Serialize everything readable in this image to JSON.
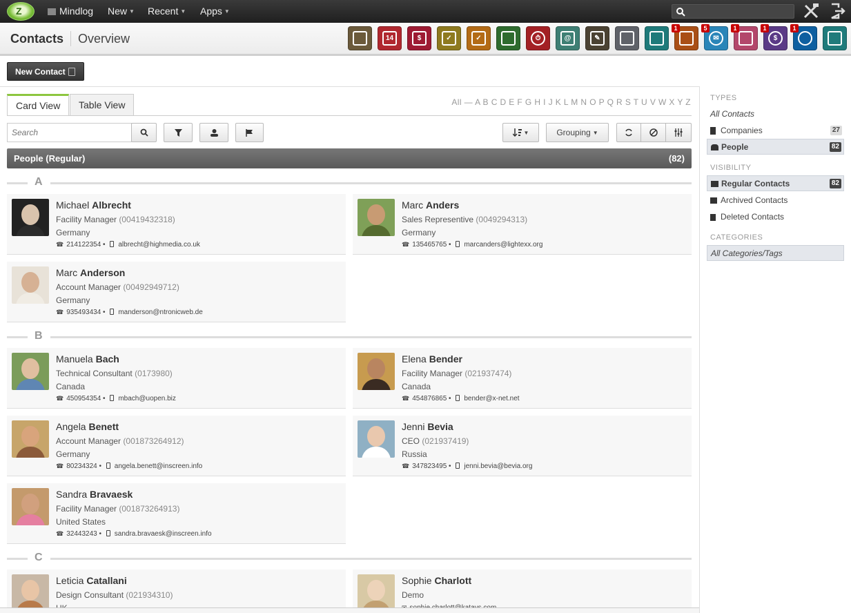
{
  "topbar": {
    "logo_text": "Z",
    "brand": "Mindlog",
    "nav": [
      {
        "label": "New"
      },
      {
        "label": "Recent"
      },
      {
        "label": "Apps"
      }
    ]
  },
  "header": {
    "title": "Contacts",
    "subtitle": "Overview"
  },
  "app_tiles": [
    {
      "name": "contacts-app-icon",
      "color": "#6b5a3b",
      "badge": "",
      "glyph": ""
    },
    {
      "name": "calendar-app-icon",
      "color": "#b0282f",
      "badge": "",
      "glyph": "14"
    },
    {
      "name": "sales-app-icon",
      "color": "#9e1b33",
      "badge": "",
      "glyph": "$"
    },
    {
      "name": "tasks-app-icon",
      "color": "#8e7a1f",
      "badge": "",
      "glyph": "✓"
    },
    {
      "name": "documents-app-icon",
      "color": "#b36b16",
      "badge": "",
      "glyph": "✓"
    },
    {
      "name": "bookmarks-app-icon",
      "color": "#2e6b2e",
      "badge": "",
      "glyph": ""
    },
    {
      "name": "timetracking-app-icon",
      "color": "#a32024",
      "badge": "",
      "glyph": "⏱"
    },
    {
      "name": "addressbook-app-icon",
      "color": "#3e7f74",
      "badge": "",
      "glyph": "@"
    },
    {
      "name": "notes-app-icon",
      "color": "#4b4233",
      "badge": "",
      "glyph": "✎"
    },
    {
      "name": "logistics-app-icon",
      "color": "#5f6269",
      "badge": "",
      "glyph": ""
    },
    {
      "name": "delivery-app-icon",
      "color": "#1e7a7a",
      "badge": "",
      "glyph": ""
    },
    {
      "name": "broadcast-app-icon",
      "color": "#a94f16",
      "badge": "1",
      "glyph": ""
    },
    {
      "name": "mail-app-icon",
      "color": "#2a85b8",
      "badge": "5",
      "glyph": "✉"
    },
    {
      "name": "deals-app-icon",
      "color": "#b3476b",
      "badge": "1",
      "glyph": ""
    },
    {
      "name": "finance-app-icon",
      "color": "#5a3a86",
      "badge": "1",
      "glyph": "$"
    },
    {
      "name": "support-app-icon",
      "color": "#0e5fa0",
      "badge": "1",
      "glyph": ""
    },
    {
      "name": "lab-app-icon",
      "color": "#1f7b7b",
      "badge": "",
      "glyph": ""
    }
  ],
  "toolbar": {
    "new_contact_label": "New Contact",
    "search_placeholder": "Search",
    "grouping_label": "Grouping"
  },
  "tabs": [
    {
      "label": "Card View"
    },
    {
      "label": "Table View"
    }
  ],
  "alphabet": "All — A B C D E F G H I J K L M N O P Q R S T U V W X Y Z",
  "group": {
    "label": "People (Regular)",
    "count": "(82)"
  },
  "letters": [
    "A",
    "B",
    "C"
  ],
  "contacts": [
    {
      "first": "Michael",
      "last": "Albrecht",
      "role": "Facility Manager",
      "phone_id": "(00419432318)",
      "country": "Germany",
      "tel": "214122354",
      "email": "albrecht@highmedia.co.uk"
    },
    {
      "first": "Marc",
      "last": "Anders",
      "role": "Sales Representive",
      "phone_id": "(0049294313)",
      "country": "Germany",
      "tel": "135465765",
      "email": "marcanders@lightexx.org"
    },
    {
      "first": "Marc",
      "last": "Anderson",
      "role": "Account Manager",
      "phone_id": "(00492949712)",
      "country": "Germany",
      "tel": "935493434",
      "email": "manderson@ntronicweb.de"
    },
    {
      "first": "Manuela",
      "last": "Bach",
      "role": "Technical Consultant",
      "phone_id": "(0173980)",
      "country": "Canada",
      "tel": "450954354",
      "email": "mbach@uopen.biz"
    },
    {
      "first": "Elena",
      "last": "Bender",
      "role": "Facility Manager",
      "phone_id": "(021937474)",
      "country": "Canada",
      "tel": "454876865",
      "email": "bender@x-net.net"
    },
    {
      "first": "Angela",
      "last": "Benett",
      "role": "Account Manager",
      "phone_id": "(001873264912)",
      "country": "Germany",
      "tel": "80234324",
      "email": "angela.benett@inscreen.info"
    },
    {
      "first": "Jenni",
      "last": "Bevia",
      "role": "CEO",
      "phone_id": "(021937419)",
      "country": "Russia",
      "tel": "347823495",
      "email": "jenni.bevia@bevia.org"
    },
    {
      "first": "Sandra",
      "last": "Bravaesk",
      "role": "Facility Manager",
      "phone_id": "(001873264913)",
      "country": "United States",
      "tel": "32443243",
      "email": "sandra.bravaesk@inscreen.info"
    },
    {
      "first": "Leticia",
      "last": "Catallani",
      "role": "Design Consultant",
      "phone_id": "(021934310)",
      "country": "UK",
      "tel": "",
      "email": ""
    },
    {
      "first": "Sophie",
      "last": "Charlott",
      "role": "Demo",
      "phone_id": "",
      "country": "",
      "tel": "",
      "email": "sophie.charlott@katays.com"
    }
  ],
  "sidebar": {
    "types_head": "TYPES",
    "all_contacts": "All Contacts",
    "companies": "Companies",
    "companies_count": "27",
    "people": "People",
    "people_count": "82",
    "visibility_head": "VISIBILITY",
    "regular": "Regular Contacts",
    "regular_count": "82",
    "archived": "Archived Contacts",
    "deleted": "Deleted Contacts",
    "categories_head": "CATEGORIES",
    "all_categories": "All Categories/Tags"
  }
}
